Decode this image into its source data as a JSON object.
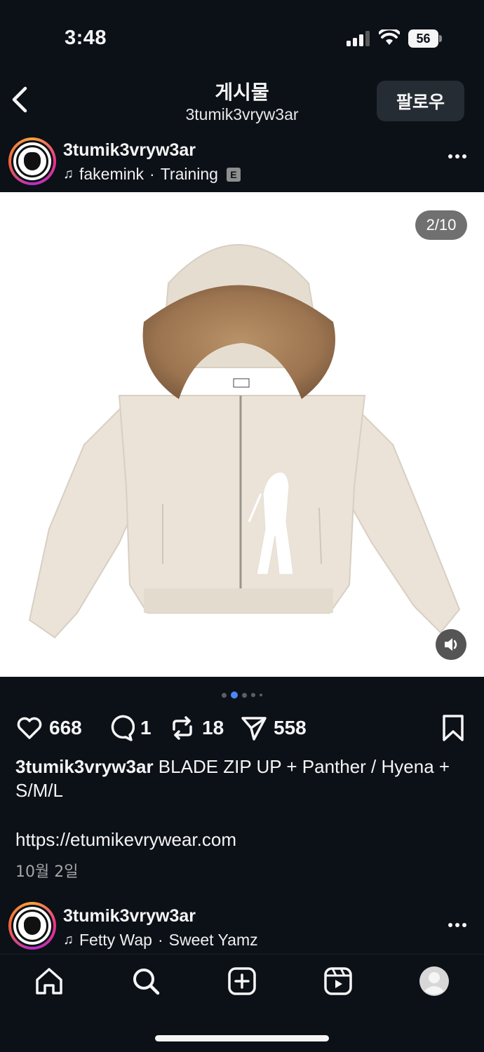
{
  "status_bar": {
    "time": "3:48",
    "battery": "56"
  },
  "header": {
    "title": "게시물",
    "subtitle": "3tumik3vryw3ar",
    "follow_label": "팔로우"
  },
  "post": {
    "username": "3tumik3vryw3ar",
    "music": {
      "artist": "fakemink",
      "song": "Training",
      "explicit_badge": "E"
    },
    "image_counter": "2/10",
    "carousel": {
      "active_index": 1
    },
    "stats": {
      "likes": "668",
      "comments": "1",
      "reposts": "18",
      "shares": "558"
    },
    "caption": {
      "username": "3tumik3vryw3ar",
      "text": "BLADE  ZIP UP +  Panther / Hyena + S/M/L"
    },
    "link": "https://etumikevrywear.com",
    "date": "10월 2일"
  },
  "next_post": {
    "username": "3tumik3vryw3ar",
    "music": {
      "artist": "Fetty Wap",
      "song": "Sweet Yamz"
    }
  },
  "icons": {
    "back": "chevron-left-icon",
    "more": "more-horizontal-icon",
    "like": "heart-icon",
    "comment": "comment-icon",
    "repost": "repost-icon",
    "share": "send-icon",
    "save": "bookmark-icon",
    "mute": "speaker-icon"
  },
  "tabbar": {
    "items": [
      "home",
      "search",
      "create",
      "reels",
      "profile"
    ]
  },
  "colors": {
    "background": "#0c1017",
    "follow_button": "#262c34",
    "active_dot": "#4a88f5",
    "hoodie": "#ebe3d8",
    "fur": "#9c7450"
  }
}
